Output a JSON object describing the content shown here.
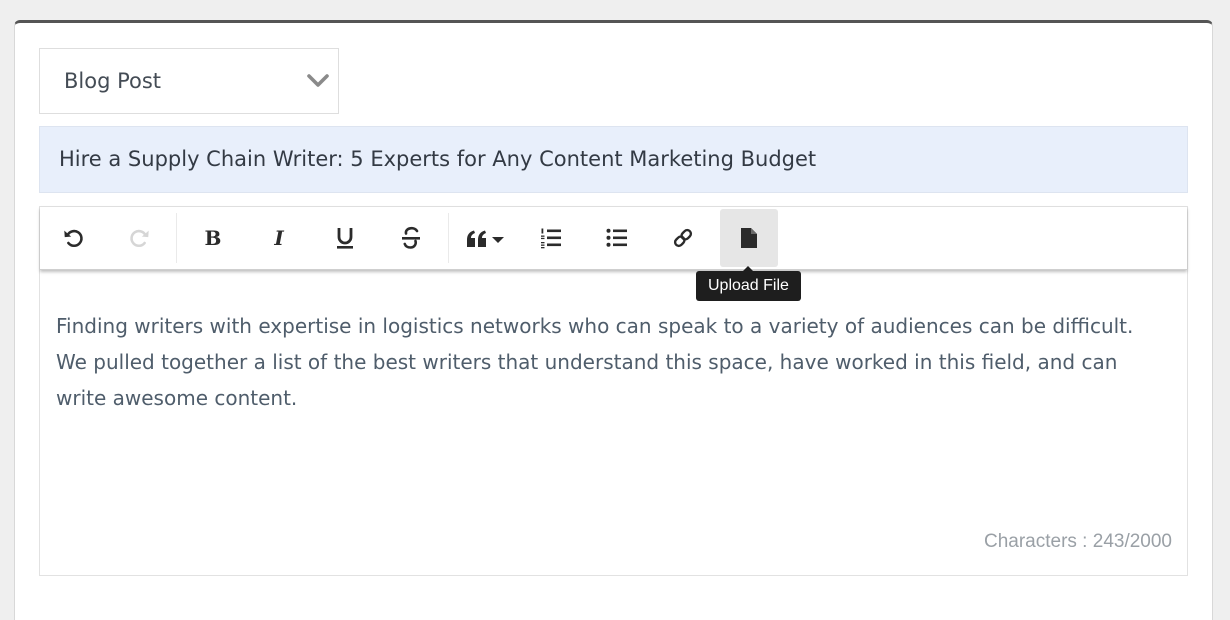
{
  "post_type_select": {
    "value": "Blog Post"
  },
  "title_field": {
    "value": "Hire a Supply Chain Writer: 5 Experts for Any Content Marketing Budget"
  },
  "toolbar": {
    "buttons": [
      {
        "name": "undo",
        "icon": "undo-icon",
        "enabled": true
      },
      {
        "name": "redo",
        "icon": "redo-icon",
        "enabled": false
      },
      {
        "name": "bold",
        "icon": "bold-icon",
        "enabled": true
      },
      {
        "name": "italic",
        "icon": "italic-icon",
        "enabled": true
      },
      {
        "name": "underline",
        "icon": "underline-icon",
        "enabled": true
      },
      {
        "name": "strikethrough",
        "icon": "strikethrough-icon",
        "enabled": true
      },
      {
        "name": "blockquote",
        "icon": "quote-dropdown-icon",
        "enabled": true
      },
      {
        "name": "ordered-list",
        "icon": "ordered-list-icon",
        "enabled": true
      },
      {
        "name": "bulleted-list",
        "icon": "bulleted-list-icon",
        "enabled": true
      },
      {
        "name": "link",
        "icon": "link-icon",
        "enabled": true
      },
      {
        "name": "upload-file",
        "icon": "file-icon",
        "enabled": true,
        "hovered": true
      }
    ],
    "tooltip": "Upload File"
  },
  "editor": {
    "content": "Finding writers with expertise in logistics networks who can speak to a variety of audiences can be difficult. We pulled together a list of the best writers that understand this space, have worked in this field, and can write awesome content.",
    "char_count_label": "Characters : ",
    "char_count_value": "243/2000"
  },
  "colors": {
    "icon": "#2b2b2b",
    "icon_disabled": "#d6d6d6",
    "title_background": "#e8effb",
    "text": "#4f5d6b"
  }
}
